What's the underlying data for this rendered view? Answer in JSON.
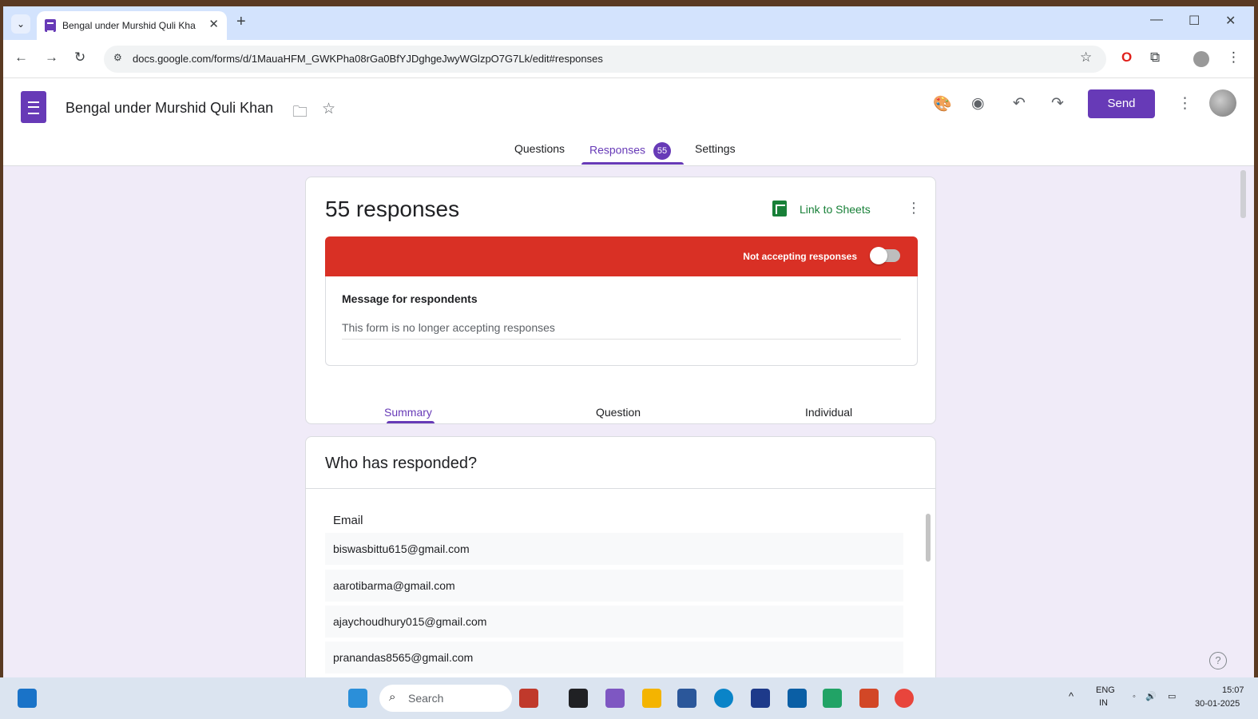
{
  "browser": {
    "tab_title": "Bengal under Murshid Quli Kha",
    "url": "docs.google.com/forms/d/1MauaHFM_GWKPha08rGa0BfYJDghgeJwyWGlzpO7G7Lk/edit#responses"
  },
  "form": {
    "title": "Bengal under Murshid Quli Khan",
    "send_label": "Send",
    "tabs": [
      {
        "label": "Questions"
      },
      {
        "label": "Responses",
        "badge": "55"
      },
      {
        "label": "Settings"
      }
    ]
  },
  "responses": {
    "count_text": "55 responses",
    "link_sheets": "Link to Sheets",
    "status_text": "Not accepting responses",
    "accepting": false,
    "message_label": "Message for respondents",
    "message_text": "This form is no longer accepting responses",
    "subtabs": [
      "Summary",
      "Question",
      "Individual"
    ]
  },
  "summary": {
    "title": "Who has responded?",
    "column_header": "Email",
    "emails": [
      "biswasbittu615@gmail.com",
      "aarotibarma@gmail.com",
      "ajaychoudhury015@gmail.com",
      "pranandas8565@gmail.com"
    ]
  },
  "taskbar": {
    "search_label": "Search",
    "lang": "ENG",
    "region": "IN",
    "time": "15:07",
    "date": "30-01-2025"
  },
  "colors": {
    "brand": "#673ab7",
    "banner": "#d93025",
    "sheets": "#188038"
  }
}
